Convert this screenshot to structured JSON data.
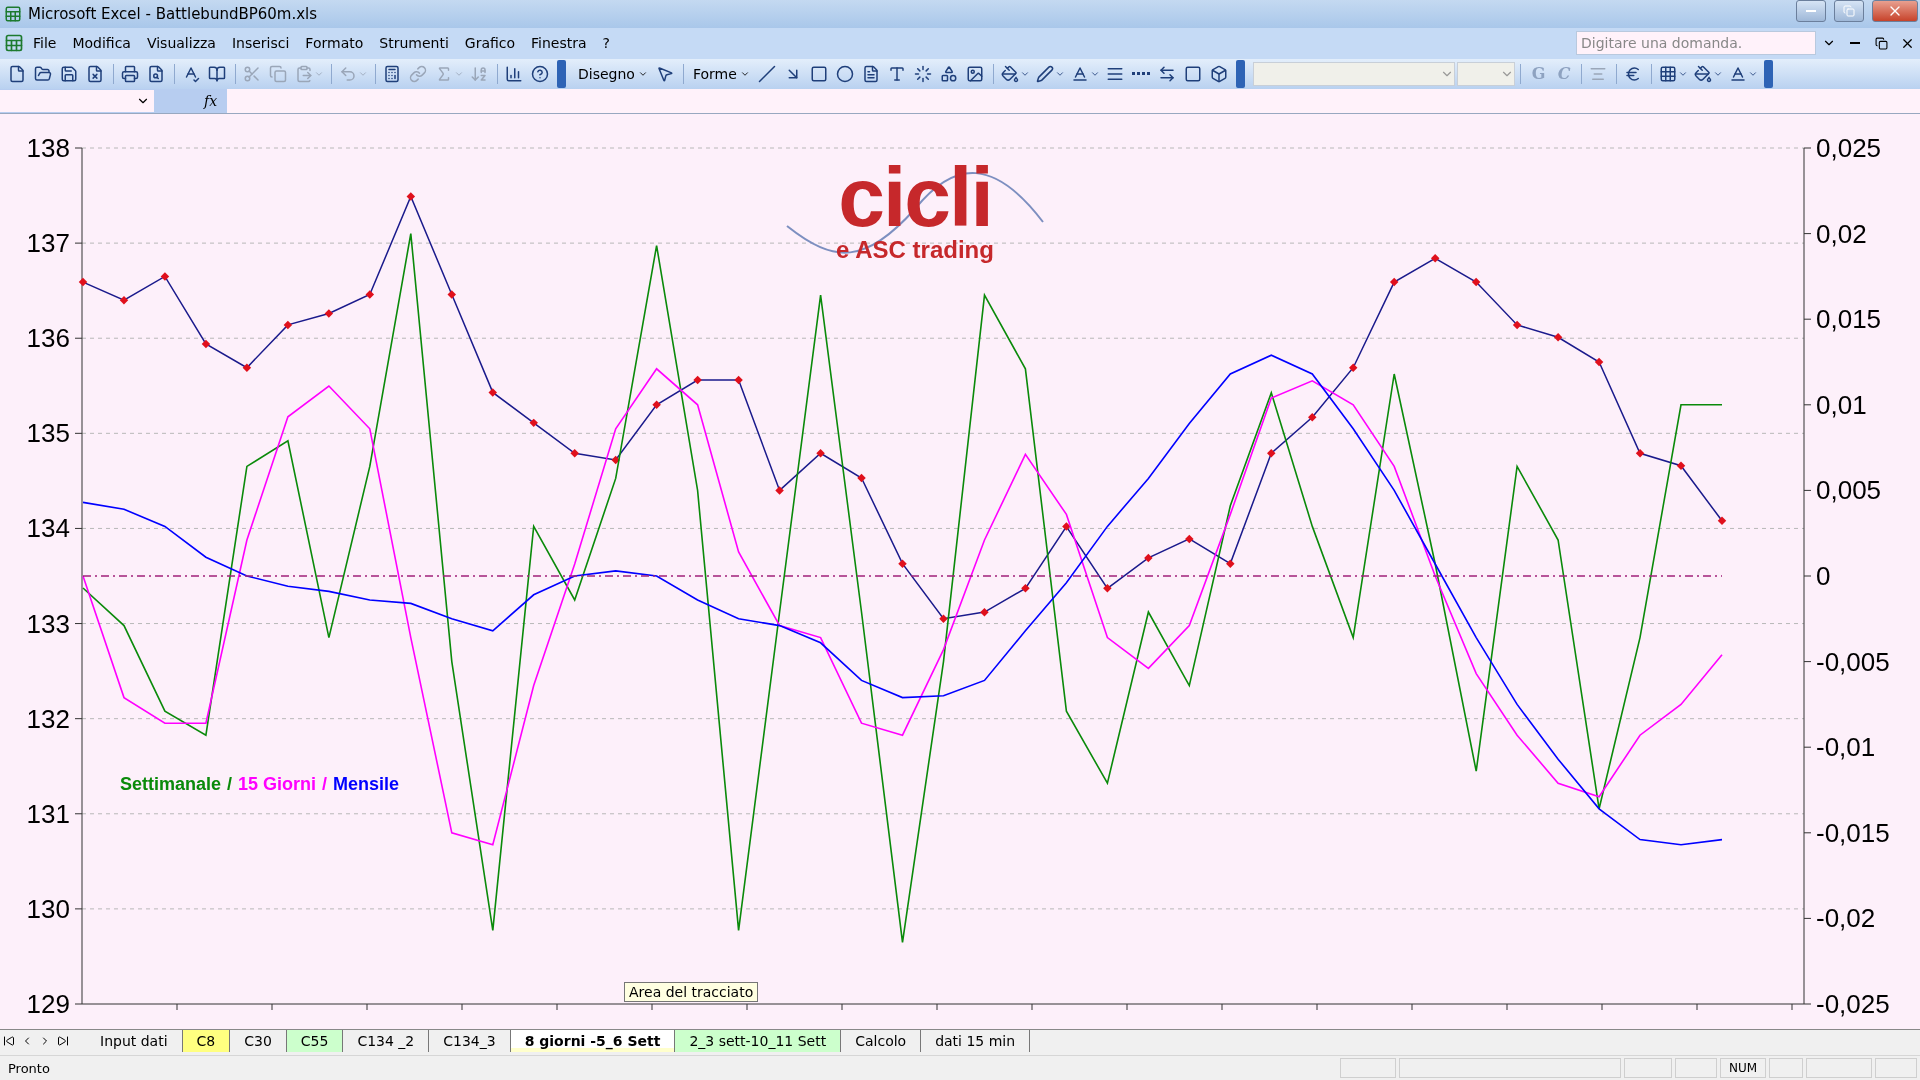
{
  "window": {
    "title": "Microsoft Excel - BattlebundBP60m.xls"
  },
  "menu": {
    "items": [
      "File",
      "Modifica",
      "Visualizza",
      "Inserisci",
      "Formato",
      "Strumenti",
      "Grafico",
      "Finestra",
      "?"
    ],
    "question_box": {
      "placeholder": "Digitare una domanda."
    }
  },
  "toolbar": {
    "items": [
      {
        "kind": "icon",
        "disabled": false,
        "menu": false
      },
      {
        "kind": "icon",
        "disabled": false,
        "menu": false
      },
      {
        "kind": "icon",
        "disabled": false,
        "menu": false
      },
      {
        "kind": "icon",
        "disabled": false,
        "menu": false
      },
      {
        "kind": "separator"
      },
      {
        "kind": "icon",
        "disabled": false,
        "menu": false
      },
      {
        "kind": "icon",
        "disabled": false,
        "menu": false
      },
      {
        "kind": "separator"
      },
      {
        "kind": "icon",
        "disabled": false,
        "menu": false
      },
      {
        "kind": "icon",
        "disabled": false,
        "menu": false
      },
      {
        "kind": "separator"
      },
      {
        "kind": "icon",
        "disabled": true,
        "menu": false
      },
      {
        "kind": "icon",
        "disabled": true,
        "menu": false
      },
      {
        "kind": "icon",
        "disabled": true,
        "menu": true
      },
      {
        "kind": "separator"
      },
      {
        "kind": "icon",
        "disabled": true,
        "menu": true
      },
      {
        "kind": "separator"
      },
      {
        "kind": "icon",
        "disabled": false,
        "menu": false
      },
      {
        "kind": "icon",
        "disabled": true,
        "menu": false
      },
      {
        "kind": "icon",
        "disabled": true,
        "menu": true
      },
      {
        "kind": "icon",
        "disabled": true,
        "menu": false
      },
      {
        "kind": "separator"
      },
      {
        "kind": "icon",
        "disabled": false,
        "menu": false
      },
      {
        "kind": "icon",
        "disabled": false,
        "menu": false
      },
      {
        "kind": "end"
      },
      {
        "kind": "text-menu",
        "label": "Disegno"
      },
      {
        "kind": "icon",
        "disabled": false,
        "menu": false
      },
      {
        "kind": "separator"
      },
      {
        "kind": "text-menu",
        "label": "Forme"
      },
      {
        "kind": "icon",
        "disabled": false,
        "menu": false
      },
      {
        "kind": "icon",
        "disabled": false,
        "menu": false
      },
      {
        "kind": "icon",
        "disabled": false,
        "menu": false
      },
      {
        "kind": "icon",
        "disabled": false,
        "menu": false
      },
      {
        "kind": "icon",
        "disabled": false,
        "menu": false
      },
      {
        "kind": "icon",
        "disabled": false,
        "menu": false
      },
      {
        "kind": "icon",
        "disabled": false,
        "menu": false
      },
      {
        "kind": "icon",
        "disabled": false,
        "menu": false
      },
      {
        "kind": "icon",
        "disabled": false,
        "menu": false
      },
      {
        "kind": "separator"
      },
      {
        "kind": "icon",
        "disabled": false,
        "menu": true
      },
      {
        "kind": "icon",
        "disabled": false,
        "menu": true
      },
      {
        "kind": "icon",
        "disabled": false,
        "menu": true
      },
      {
        "kind": "icon",
        "disabled": false,
        "menu": false
      },
      {
        "kind": "icon",
        "disabled": false,
        "menu": false
      },
      {
        "kind": "icon",
        "disabled": false,
        "menu": false
      },
      {
        "kind": "icon",
        "disabled": false,
        "menu": false
      },
      {
        "kind": "icon",
        "disabled": false,
        "menu": false
      },
      {
        "kind": "end"
      },
      {
        "kind": "select"
      },
      {
        "kind": "select"
      },
      {
        "kind": "separator"
      },
      {
        "kind": "letter",
        "label": "G",
        "disabled": true
      },
      {
        "kind": "letter",
        "label": "C",
        "disabled": true
      },
      {
        "kind": "separator"
      },
      {
        "kind": "icon",
        "disabled": true,
        "menu": false
      },
      {
        "kind": "separator"
      },
      {
        "kind": "icon",
        "disabled": false,
        "menu": false
      },
      {
        "kind": "separator"
      },
      {
        "kind": "icon",
        "disabled": false,
        "menu": true
      },
      {
        "kind": "icon",
        "disabled": false,
        "menu": true
      },
      {
        "kind": "icon",
        "disabled": false,
        "menu": true
      },
      {
        "kind": "end"
      }
    ]
  },
  "formula_bar": {
    "fx": "fx"
  },
  "chart": {
    "logo": {
      "title": "cicli",
      "subtitle": "e ASC trading"
    },
    "legend_separator": "/",
    "tooltip": "Area del tracciato",
    "price_panel": {
      "chart_data": {
        "type": "line",
        "grid": true,
        "categories": [
          null,
          null,
          null,
          null,
          null,
          null,
          null,
          null,
          null,
          null,
          null,
          null,
          null,
          null,
          null,
          null,
          null,
          null,
          null,
          null,
          null,
          null,
          null,
          null,
          null,
          null,
          null,
          null,
          null,
          null,
          null,
          null,
          null,
          null,
          null,
          null,
          null,
          null,
          null,
          null,
          null
        ],
        "ylim": [
          129,
          138
        ],
        "yticks": [
          129,
          130,
          131,
          132,
          133,
          134,
          135,
          136,
          137,
          138
        ],
        "series": [
          {
            "color": "#1a1a8c",
            "marker": "diamond",
            "values": [
              136.59,
              136.4,
              136.65,
              135.94,
              135.69,
              136.14,
              136.26,
              136.46,
              137.49,
              136.46,
              135.43,
              135.11,
              134.79,
              134.72,
              135.3,
              135.56,
              135.56,
              134.4,
              134.79,
              134.53,
              133.63,
              133.05,
              133.12,
              133.37,
              134.02,
              133.37,
              133.69,
              133.89,
              133.63,
              134.79,
              135.17,
              135.69,
              136.59,
              136.84,
              136.59,
              136.14,
              136.01,
              135.75,
              134.79,
              134.66,
              134.08
            ]
          }
        ]
      }
    },
    "cycles_panel": {
      "chart_data": {
        "type": "line",
        "categories": [
          null,
          null,
          null,
          null,
          null,
          null,
          null,
          null,
          null,
          null,
          null,
          null,
          null,
          null,
          null,
          null,
          null,
          null,
          null,
          null,
          null,
          null,
          null,
          null,
          null,
          null,
          null,
          null,
          null,
          null,
          null,
          null,
          null,
          null,
          null,
          null,
          null,
          null,
          null,
          null,
          null
        ],
        "ylim": [
          -0.025,
          0.025
        ],
        "yticks": [
          {
            "value": -0.025,
            "label": "-0,025"
          },
          {
            "value": -0.02,
            "label": "-0,02"
          },
          {
            "value": -0.015,
            "label": "-0,015"
          },
          {
            "value": -0.01,
            "label": "-0,01"
          },
          {
            "value": -0.005,
            "label": "-0,005"
          },
          {
            "value": 0,
            "label": "0"
          },
          {
            "value": 0.005,
            "label": "0,005"
          },
          {
            "value": 0.01,
            "label": "0,01"
          },
          {
            "value": 0.015,
            "label": "0,015"
          },
          {
            "value": 0.02,
            "label": "0,02"
          },
          {
            "value": 0.025,
            "label": "0,025"
          }
        ],
        "series": [
          {
            "name": "Settimanale",
            "color": "#0a8a0a",
            "values": [
              -0.0007,
              -0.0029,
              -0.0079,
              -0.0093,
              0.0064,
              0.0079,
              -0.0036,
              0.0064,
              0.02,
              -0.005,
              -0.0207,
              0.0029,
              -0.0014,
              0.0057,
              0.0193,
              0.005,
              -0.0207,
              -0.0021,
              0.0164,
              -0.0021,
              -0.0214,
              -0.005,
              0.0164,
              0.0121,
              -0.0079,
              -0.0121,
              -0.0021,
              -0.0064,
              0.0041,
              0.0107,
              0.0029,
              -0.0036,
              0.0118,
              0.0007,
              -0.0114,
              0.0064,
              0.0021,
              -0.0136,
              -0.0036,
              0.01,
              0.01
            ]
          },
          {
            "name": "15 Giorni",
            "color": "#ff00ff",
            "values": [
              0,
              -0.0071,
              -0.0086,
              -0.0086,
              0.0021,
              0.0093,
              0.0111,
              0.0086,
              -0.0036,
              -0.015,
              -0.0157,
              -0.0064,
              0.0007,
              0.0086,
              0.0121,
              0.01,
              0.0014,
              -0.0029,
              -0.0036,
              -0.0086,
              -0.0093,
              -0.0043,
              0.0021,
              0.0071,
              0.0036,
              -0.0036,
              -0.0054,
              -0.0029,
              0.0036,
              0.0104,
              0.0114,
              0.01,
              0.0064,
              0,
              -0.0057,
              -0.0093,
              -0.0121,
              -0.0129,
              -0.0093,
              -0.0075,
              -0.0046
            ]
          },
          {
            "name": "Mensile",
            "color": "#0000ff",
            "values": [
              0.0043,
              0.0039,
              0.0029,
              0.0011,
              0,
              -0.0006,
              -0.0009,
              -0.0014,
              -0.0016,
              -0.0025,
              -0.0032,
              -0.0011,
              0,
              0.0003,
              0,
              -0.0014,
              -0.0025,
              -0.0029,
              -0.0039,
              -0.0061,
              -0.0071,
              -0.007,
              -0.0061,
              -0.0032,
              -0.0004,
              0.0029,
              0.0057,
              0.0089,
              0.0118,
              0.0129,
              0.0118,
              0.0086,
              0.005,
              0.0007,
              -0.0036,
              -0.0075,
              -0.0107,
              -0.0136,
              -0.0154,
              -0.0157,
              -0.0154
            ]
          },
          {
            "color": "#a0207a",
            "line_style": "dashdot",
            "values": [
              0,
              0,
              0,
              0,
              0,
              0,
              0,
              0,
              0,
              0,
              0,
              0,
              0,
              0,
              0,
              0,
              0,
              0,
              0,
              0,
              0,
              0,
              0,
              0,
              0,
              0,
              0,
              0,
              0,
              0,
              0,
              0,
              0,
              0,
              0,
              0,
              0,
              0,
              0,
              0,
              0
            ]
          }
        ]
      }
    }
  },
  "sheet_tabs": [
    {
      "label": "Input dati",
      "selected": false,
      "color": "#f0f0f0"
    },
    {
      "label": "C8",
      "selected": false,
      "color": "#ffff80"
    },
    {
      "label": "C30",
      "selected": false,
      "color": "#f0f0f0"
    },
    {
      "label": "C55",
      "selected": false,
      "color": "#ccffcc"
    },
    {
      "label": "C134 _2",
      "selected": false,
      "color": "#f0f0f0"
    },
    {
      "label": "C134_3",
      "selected": false,
      "color": "#f0f0f0"
    },
    {
      "label": "8 giorni -5_6 Sett",
      "selected": true,
      "color": "#ffffcc"
    },
    {
      "label": "2_3 sett-10_11 Sett",
      "selected": false,
      "color": "#ccffcc"
    },
    {
      "label": "Calcolo",
      "selected": false,
      "color": "#f0f0f0"
    },
    {
      "label": "dati 15 min",
      "selected": false,
      "color": "#f0f0f0"
    }
  ],
  "status_bar": {
    "status": "Pronto",
    "indicators": [
      "NUM"
    ]
  }
}
